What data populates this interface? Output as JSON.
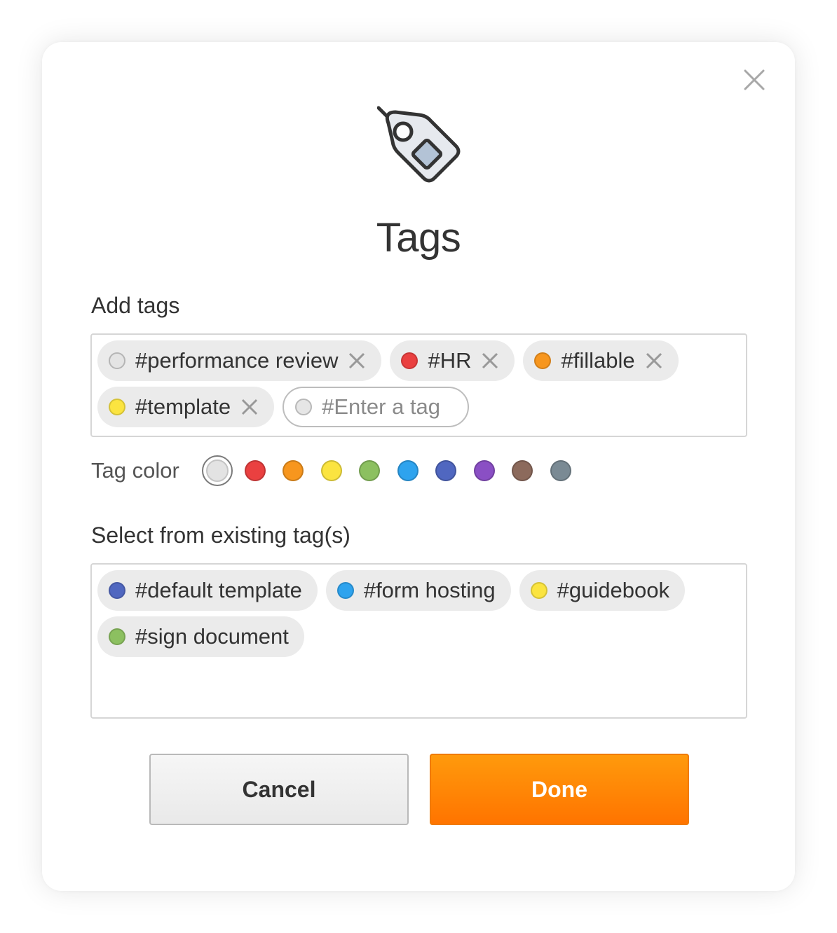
{
  "dialog": {
    "title": "Tags",
    "close_icon": "close-icon",
    "hero_icon": "tag-icon"
  },
  "add_tags": {
    "label": "Add tags",
    "tags": [
      {
        "text": "#performance review",
        "color": "#e4e4e4"
      },
      {
        "text": "#HR",
        "color": "#ea4040"
      },
      {
        "text": "#fillable",
        "color": "#f7961e"
      },
      {
        "text": "#template",
        "color": "#fbe440"
      }
    ],
    "input_placeholder": "#Enter a tag",
    "input_value": ""
  },
  "tag_color": {
    "label": "Tag color",
    "selected": "#e3e3e3",
    "swatches": [
      "#e3e3e3",
      "#ea4040",
      "#f7961e",
      "#fbe440",
      "#8cc060",
      "#2ea3ee",
      "#5067c0",
      "#8a4fc4",
      "#8c6a5c",
      "#7a8a94"
    ]
  },
  "existing_tags": {
    "label": "Select from existing tag(s)",
    "tags": [
      {
        "text": "#default template",
        "color": "#5067c0"
      },
      {
        "text": "#form hosting",
        "color": "#2ea3ee"
      },
      {
        "text": "#guidebook",
        "color": "#fbe440"
      },
      {
        "text": "#sign document",
        "color": "#8cc060"
      }
    ]
  },
  "actions": {
    "cancel_label": "Cancel",
    "done_label": "Done"
  }
}
